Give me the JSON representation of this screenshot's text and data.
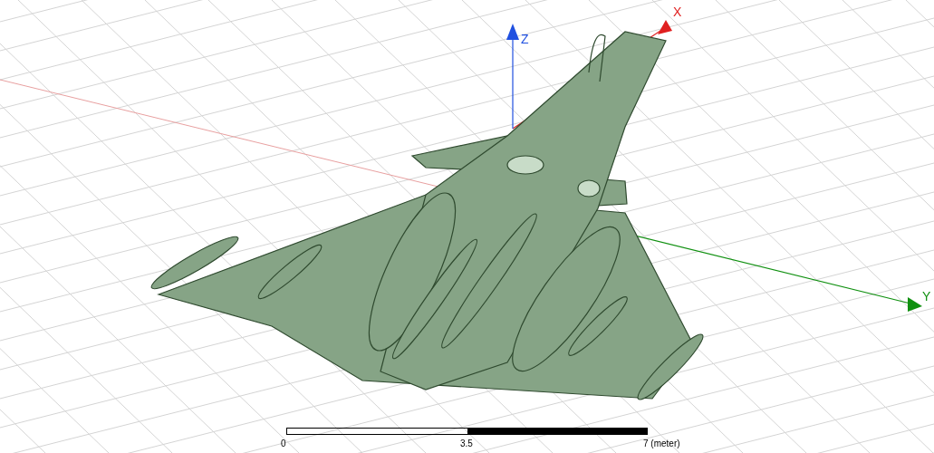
{
  "axes": [
    {
      "kind": "x",
      "label": "X"
    },
    {
      "kind": "y",
      "label": "Y"
    },
    {
      "kind": "z",
      "label": "Z"
    }
  ],
  "scale_bar": {
    "ticks": [
      "0",
      "3.5",
      "7 (meter)"
    ]
  }
}
